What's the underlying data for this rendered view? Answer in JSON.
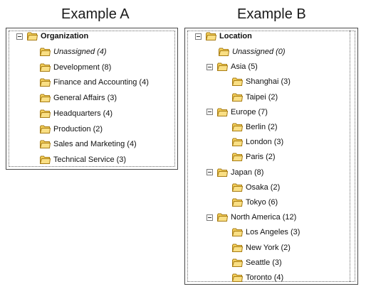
{
  "exampleA": {
    "title": "Example A",
    "root": {
      "label": "Organization",
      "expanded": true
    },
    "items": [
      {
        "label": "Unassigned",
        "count": "(4)",
        "italic": true
      },
      {
        "label": "Development",
        "count": "(8)"
      },
      {
        "label": "Finance and Accounting",
        "count": "(4)"
      },
      {
        "label": "General Affairs",
        "count": "(3)"
      },
      {
        "label": "Headquarters",
        "count": "(4)"
      },
      {
        "label": "Production",
        "count": "(2)"
      },
      {
        "label": "Sales and Marketing",
        "count": "(4)"
      },
      {
        "label": "Technical Service",
        "count": "(3)"
      }
    ]
  },
  "exampleB": {
    "title": "Example B",
    "root": {
      "label": "Location",
      "expanded": true
    },
    "nodes": [
      {
        "label": "Unassigned",
        "count": "(0)",
        "italic": true,
        "level": 1
      },
      {
        "label": "Asia",
        "count": "(5)",
        "level": 1,
        "expander": true
      },
      {
        "label": "Shanghai",
        "count": "(3)",
        "level": 2
      },
      {
        "label": "Taipei",
        "count": "(2)",
        "level": 2
      },
      {
        "label": "Europe",
        "count": "(7)",
        "level": 1,
        "expander": true
      },
      {
        "label": "Berlin",
        "count": "(2)",
        "level": 2
      },
      {
        "label": "London",
        "count": "(3)",
        "level": 2
      },
      {
        "label": "Paris",
        "count": "(2)",
        "level": 2
      },
      {
        "label": "Japan",
        "count": "(8)",
        "level": 1,
        "expander": true
      },
      {
        "label": "Osaka",
        "count": "(2)",
        "level": 2
      },
      {
        "label": "Tokyo",
        "count": "(6)",
        "level": 2
      },
      {
        "label": "North America",
        "count": "(12)",
        "level": 1,
        "expander": true
      },
      {
        "label": "Los Angeles",
        "count": "(3)",
        "level": 2
      },
      {
        "label": "New York",
        "count": "(2)",
        "level": 2
      },
      {
        "label": "Seattle",
        "count": "(3)",
        "level": 2
      },
      {
        "label": "Toronto",
        "count": "(4)",
        "level": 2
      }
    ]
  },
  "colors": {
    "folder_fill": "#f3cf5a",
    "folder_stroke": "#a87c14",
    "border": "#4a4a4a"
  },
  "icons": {
    "folder": "folder-icon",
    "collapse": "collapse-minus-icon"
  }
}
